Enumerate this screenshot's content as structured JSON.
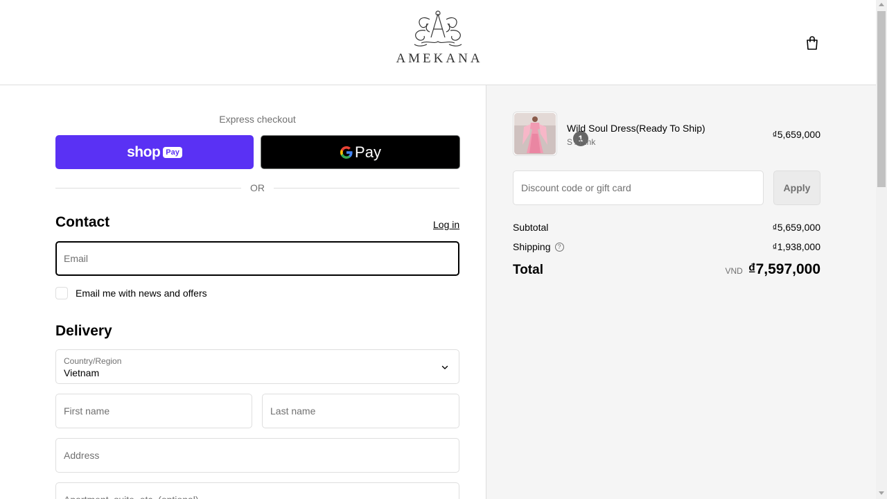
{
  "header": {
    "brand": "AMEKANA",
    "cart_icon": "shopping-bag-icon"
  },
  "checkout": {
    "express_label": "Express checkout",
    "shop_pay_word": "shop",
    "shop_pay_pill": "Pay",
    "google_pay_word": "Pay",
    "or_label": "OR",
    "contact_title": "Contact",
    "login_label": "Log in",
    "email_placeholder": "Email",
    "news_label": "Email me with news and offers",
    "delivery_title": "Delivery",
    "country_label": "Country/Region",
    "country_value": "Vietnam",
    "first_name_placeholder": "First name",
    "last_name_placeholder": "Last name",
    "address_placeholder": "Address",
    "apartment_placeholder": "Apartment, suite, etc. (optional)"
  },
  "summary": {
    "item": {
      "quantity": "1",
      "name": "Wild Soul Dress(Ready To Ship)",
      "variant": "S / Pink",
      "price": "₫5,659,000"
    },
    "discount_placeholder": "Discount code or gift card",
    "apply_label": "Apply",
    "subtotal_label": "Subtotal",
    "subtotal_value": "₫5,659,000",
    "shipping_label": "Shipping",
    "shipping_value": "₫1,938,000",
    "total_label": "Total",
    "total_currency": "VND",
    "total_value": "₫7,597,000"
  },
  "colors": {
    "shop_pay": "#5a31f4",
    "google_pay": "#000000",
    "summary_bg": "#f5f5f5",
    "border": "#dedede"
  }
}
